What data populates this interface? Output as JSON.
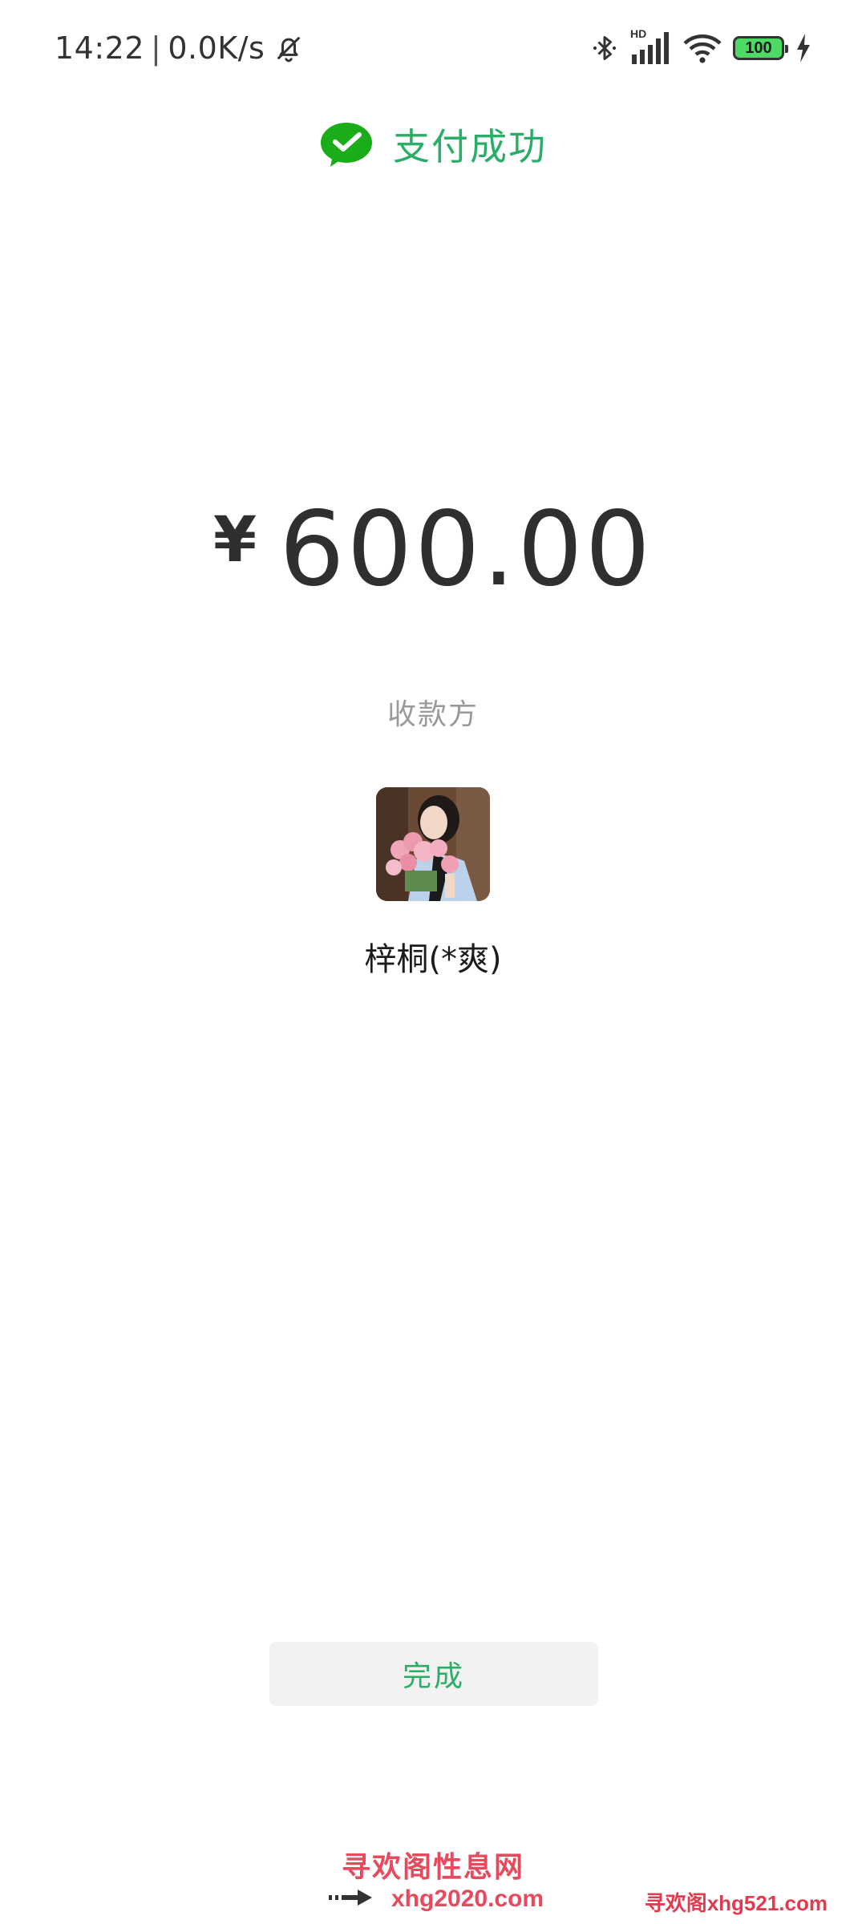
{
  "status_bar": {
    "time": "14:22",
    "separator": "|",
    "network_speed": "0.0K/s",
    "signal_label": "HD",
    "battery_level": "100",
    "icons": [
      "bell-muted-icon",
      "bluetooth-icon",
      "signal-icon",
      "wifi-icon",
      "battery-icon",
      "charging-icon"
    ]
  },
  "header": {
    "title": "支付成功",
    "icon": "wechat-success-icon"
  },
  "payment": {
    "currency_symbol": "¥",
    "amount": "600.00"
  },
  "payee": {
    "label": "收款方",
    "name": "梓桐(*爽)"
  },
  "actions": {
    "done_label": "完成"
  },
  "watermark": {
    "title": "寻欢阁性息网",
    "url": "xhg2020.com",
    "corner": "寻欢阁xhg521.com"
  },
  "colors": {
    "accent": "#2aae67",
    "watermark": "#e8495d"
  }
}
